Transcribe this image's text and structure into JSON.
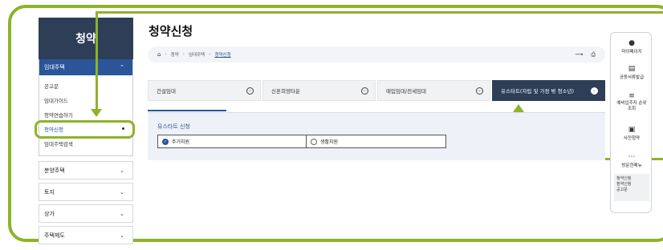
{
  "sidebar": {
    "title": "청약",
    "group": {
      "label": "임대주택",
      "items": [
        "공고문",
        "임대가이드",
        "청약연습하기",
        "청약신청",
        "임대주택검색"
      ]
    },
    "menus": [
      "분양주택",
      "토지",
      "상가",
      "주택제도"
    ]
  },
  "page": {
    "title": "청약신청",
    "breadcrumb": [
      "청약",
      "임대주택",
      "청약신청"
    ]
  },
  "tabs": [
    "건설임대",
    "신혼희망타운",
    "매입임대/전세임대",
    "유스타트(자립 및 가정 밖 청소년)"
  ],
  "panel": {
    "title": "유스타트 신청",
    "options": [
      "주거지원",
      "생활지원"
    ],
    "selected": "주거지원"
  },
  "quick": {
    "items": [
      "마이페이지",
      "공동서류발급",
      "예비입주자 순위 조회",
      "사전청약",
      "방문한메뉴"
    ],
    "recent": [
      "청약신청",
      "청약신청",
      "공고문"
    ]
  },
  "colors": {
    "highlight": "#8db32a",
    "navy": "#2e3e57",
    "blue": "#2a5599"
  }
}
